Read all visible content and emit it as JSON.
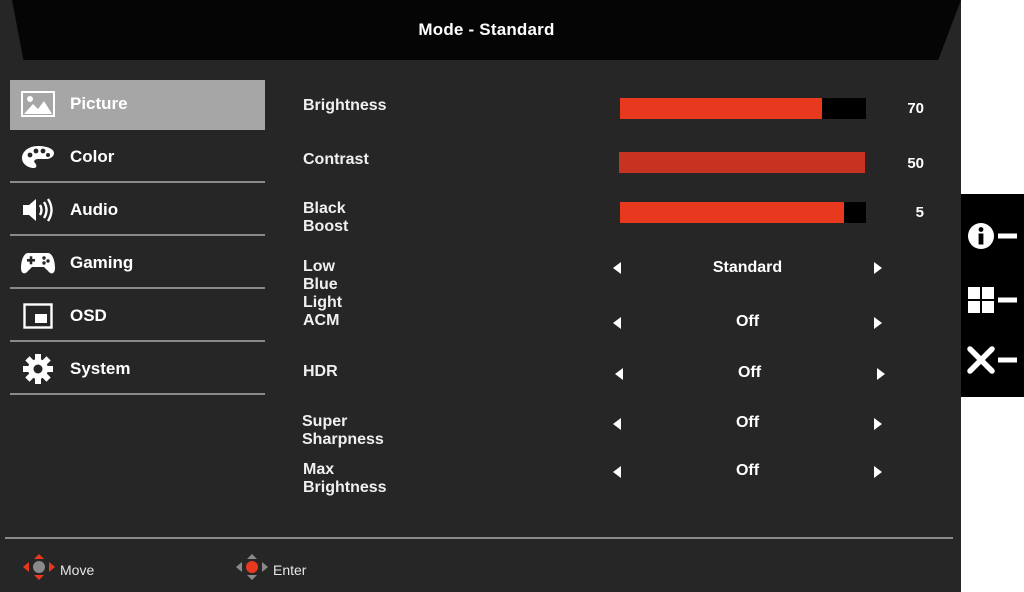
{
  "title": "Mode - Standard",
  "menu": [
    {
      "label": "Picture",
      "icon": "picture-icon",
      "active": true
    },
    {
      "label": "Color",
      "icon": "palette-icon",
      "active": false
    },
    {
      "label": "Audio",
      "icon": "speaker-icon",
      "active": false
    },
    {
      "label": "Gaming",
      "icon": "gamepad-icon",
      "active": false
    },
    {
      "label": "OSD",
      "icon": "osd-window-icon",
      "active": false
    },
    {
      "label": "System",
      "icon": "gear-icon",
      "active": false
    }
  ],
  "sliders": [
    {
      "label": "Brightness",
      "value": "70",
      "fill": 0.82
    },
    {
      "label": "Contrast",
      "value": "50",
      "fill": 1.0
    },
    {
      "label": "Black Boost",
      "value": "5",
      "fill": 0.91
    }
  ],
  "options": [
    {
      "label": "Low Blue Light",
      "value": "Standard"
    },
    {
      "label": "ACM",
      "value": "Off"
    },
    {
      "label": "HDR",
      "value": "Off"
    },
    {
      "label": "Super Sharpness",
      "value": "Off"
    },
    {
      "label": "Max Brightness",
      "value": "Off"
    }
  ],
  "footer": {
    "move": "Move",
    "enter": "Enter"
  },
  "side_keys": [
    "info-icon",
    "grid-icon",
    "close-icon"
  ],
  "colors": {
    "accent": "#e8391e",
    "contrast_fill": "#c83220",
    "active_menu": "#a6a6a6",
    "panel": "#262626"
  }
}
